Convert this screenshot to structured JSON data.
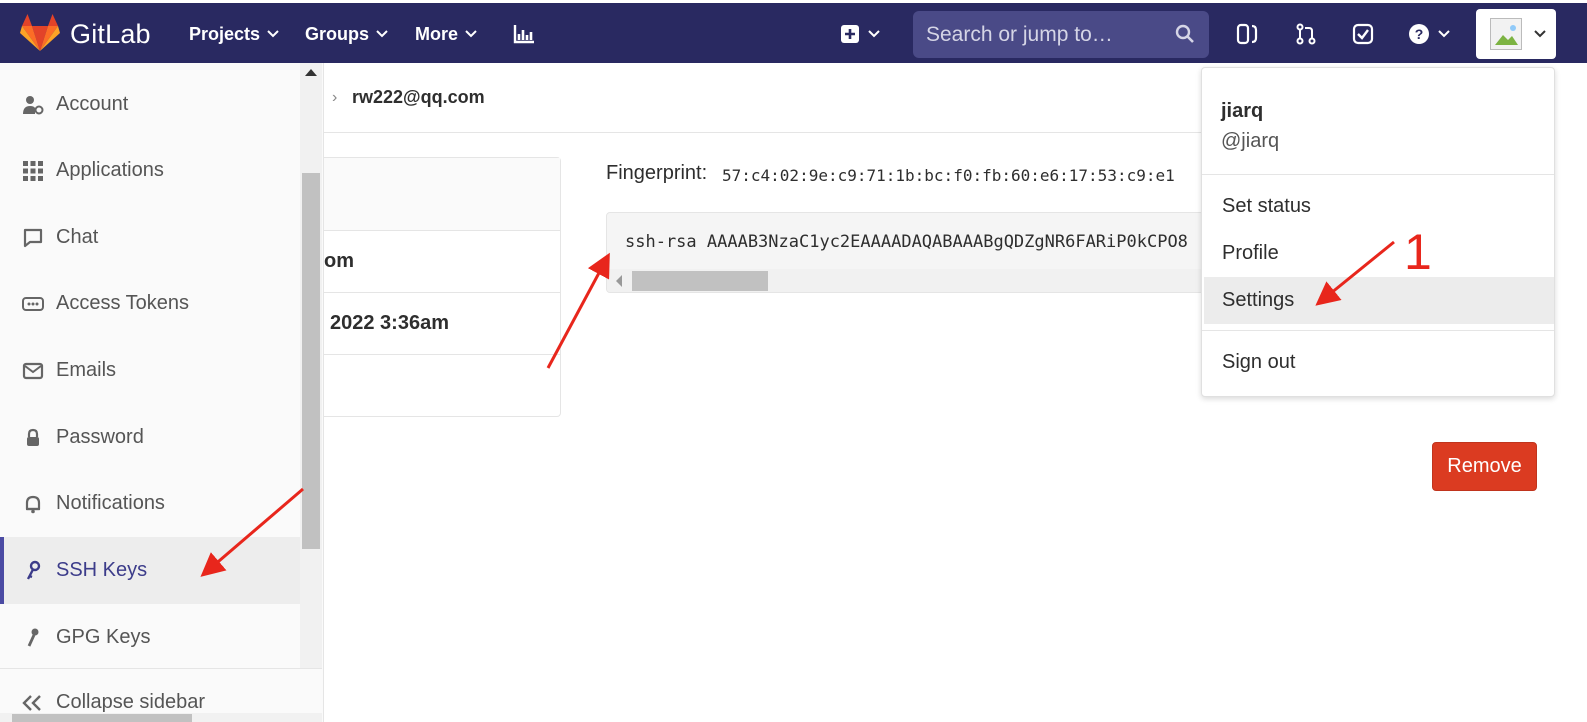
{
  "navbar": {
    "brand": "GitLab",
    "links": [
      {
        "label": "Projects"
      },
      {
        "label": "Groups"
      },
      {
        "label": "More"
      }
    ],
    "search_placeholder": "Search or jump to…"
  },
  "sidebar": {
    "items": [
      {
        "label": "Account",
        "icon": "user-settings-icon"
      },
      {
        "label": "Applications",
        "icon": "grid-icon"
      },
      {
        "label": "Chat",
        "icon": "chat-icon"
      },
      {
        "label": "Access Tokens",
        "icon": "token-icon"
      },
      {
        "label": "Emails",
        "icon": "mail-icon"
      },
      {
        "label": "Password",
        "icon": "lock-icon"
      },
      {
        "label": "Notifications",
        "icon": "bell-icon"
      },
      {
        "label": "SSH Keys",
        "icon": "key-icon",
        "active": true
      },
      {
        "label": "GPG Keys",
        "icon": "key-icon"
      }
    ],
    "collapse_label": "Collapse sidebar"
  },
  "breadcrumb": {
    "current": "rw222@qq.com"
  },
  "key_info": {
    "row1": "om",
    "row2": "2022 3:36am"
  },
  "key_details": {
    "fingerprint_label": "Fingerprint:",
    "fingerprint_value": "57:c4:02:9e:c9:71:1b:bc:f0:fb:60:e6:17:53:c9:e1",
    "key_text": "ssh-rsa AAAAB3NzaC1yc2EAAAADAQABAAABgQDZgNR6FARiP0kCPO8"
  },
  "remove_button": "Remove",
  "user_menu": {
    "name": "jiarq",
    "handle": "@jiarq",
    "items": [
      {
        "label": "Set status"
      },
      {
        "label": "Profile"
      },
      {
        "label": "Settings",
        "highlighted": true
      },
      {
        "label": "Sign out"
      }
    ]
  },
  "annotations": {
    "step_number": "1",
    "arrow_color": "#e8261c"
  },
  "colors": {
    "navbar": "#292961",
    "danger": "#db3b21",
    "active_accent": "#4b4ba3"
  }
}
